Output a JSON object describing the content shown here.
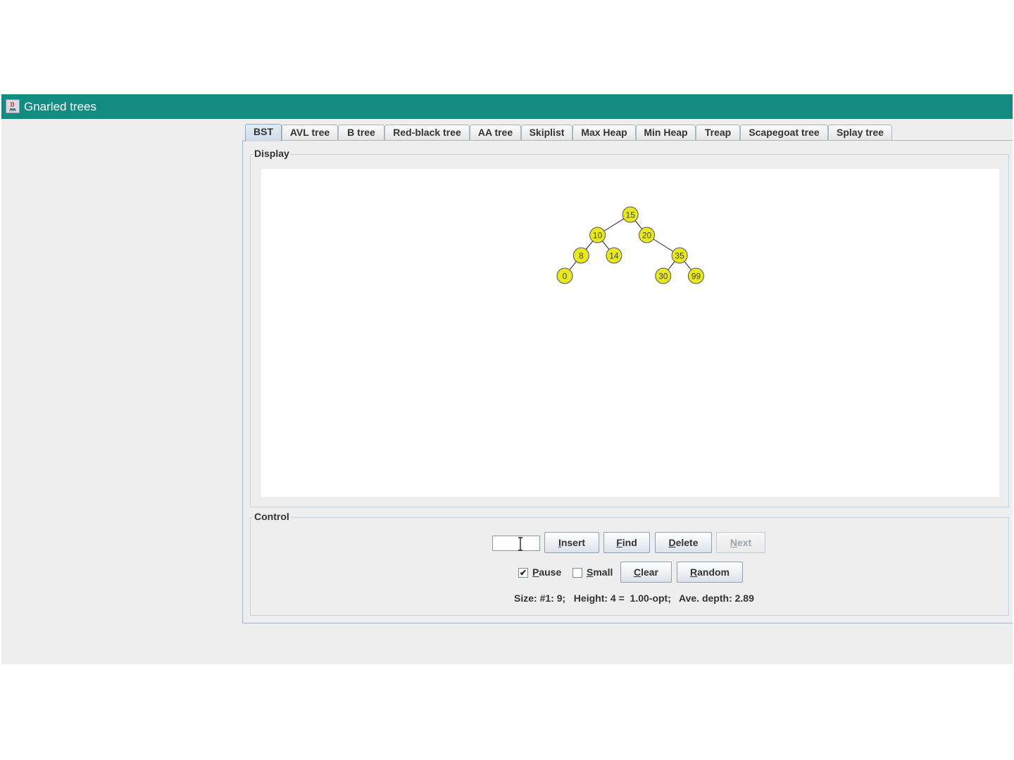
{
  "window": {
    "title": "Gnarled trees"
  },
  "tabs": [
    {
      "label": "BST",
      "active": true
    },
    {
      "label": "AVL tree"
    },
    {
      "label": "B tree"
    },
    {
      "label": "Red-black tree"
    },
    {
      "label": "AA tree"
    },
    {
      "label": "Skiplist"
    },
    {
      "label": "Max Heap"
    },
    {
      "label": "Min Heap"
    },
    {
      "label": "Treap"
    },
    {
      "label": "Scapegoat tree"
    },
    {
      "label": "Splay tree"
    }
  ],
  "display": {
    "label": "Display"
  },
  "tree": {
    "node_color": "#e8e81f",
    "nodes": [
      {
        "key": "15",
        "depth": 0
      },
      {
        "key": "10",
        "depth": 1
      },
      {
        "key": "20",
        "depth": 1
      },
      {
        "key": "8",
        "depth": 2
      },
      {
        "key": "14",
        "depth": 2
      },
      {
        "key": "35",
        "depth": 2
      },
      {
        "key": "0",
        "depth": 3
      },
      {
        "key": "30",
        "depth": 3
      },
      {
        "key": "99",
        "depth": 3
      }
    ],
    "edges": [
      [
        "15",
        "10"
      ],
      [
        "15",
        "20"
      ],
      [
        "10",
        "8"
      ],
      [
        "10",
        "14"
      ],
      [
        "20",
        "35"
      ],
      [
        "8",
        "0"
      ],
      [
        "35",
        "30"
      ],
      [
        "35",
        "99"
      ]
    ]
  },
  "control": {
    "label": "Control",
    "input_value": "",
    "insert_label": "nsert",
    "insert_mnemonic": "I",
    "find_label": "ind",
    "find_mnemonic": "F",
    "delete_label": "elete",
    "delete_mnemonic": "D",
    "next_label": "ext",
    "next_mnemonic": "N",
    "pause_label": "ause",
    "pause_mnemonic": "P",
    "pause_checked": true,
    "small_label": "mall",
    "small_mnemonic": "S",
    "small_checked": false,
    "clear_label": "lear",
    "clear_mnemonic": "C",
    "random_label": "andom",
    "random_mnemonic": "R",
    "status": "Size: #1: 9;   Height: 4 =  1.00-opt;   Ave. depth: 2.89"
  }
}
